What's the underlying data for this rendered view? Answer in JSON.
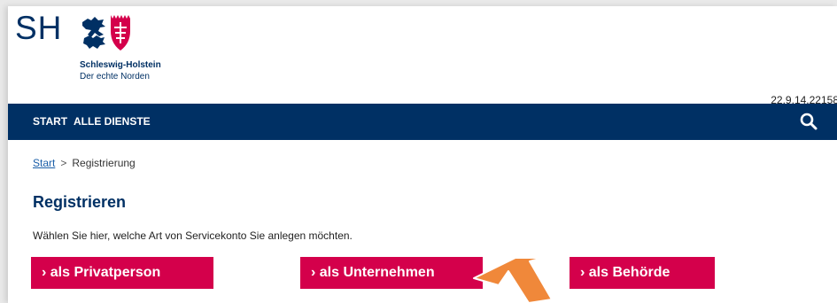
{
  "logo": {
    "abbr": "SH",
    "name": "Schleswig-Holstein",
    "tagline": "Der echte Norden"
  },
  "version": "22.9.14.22158",
  "nav": {
    "items": [
      {
        "label": "START"
      },
      {
        "label": "ALLE DIENSTE"
      }
    ],
    "search_icon": "search-icon"
  },
  "breadcrumb": {
    "home": "Start",
    "separator": ">",
    "current": "Registrierung"
  },
  "main": {
    "title": "Registrieren",
    "description": "Wählen Sie hier, welche Art von Servicekonto Sie anlegen möchten.",
    "buttons": [
      {
        "label": "› als Privatperson"
      },
      {
        "label": "› als Unternehmen"
      },
      {
        "label": "› als Behörde"
      }
    ]
  },
  "colors": {
    "primary": "#003064",
    "accent": "#d4004b",
    "pointer_arrow": "#f0883a"
  }
}
